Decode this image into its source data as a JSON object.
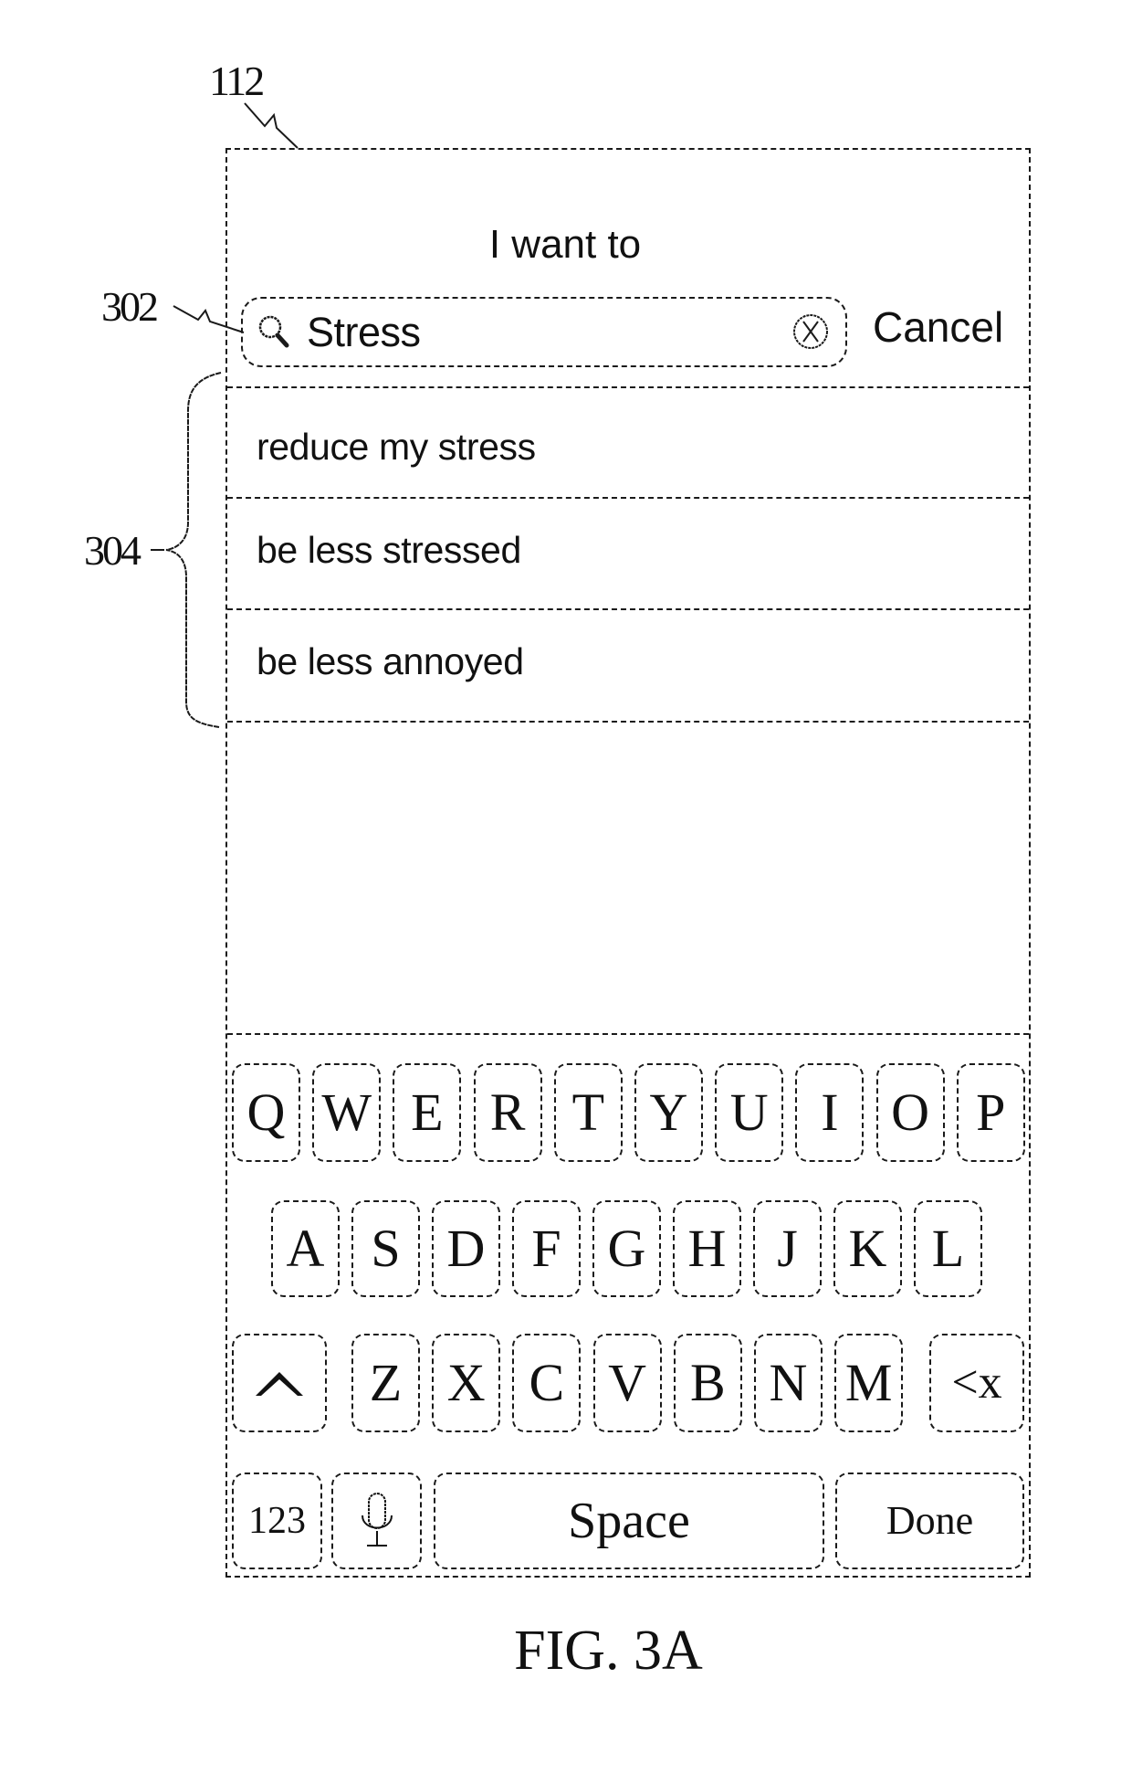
{
  "figure": {
    "caption": "FIG. 3A",
    "reference_numerals": {
      "device_screen": "112",
      "search_field": "302",
      "suggestion_list": "304"
    }
  },
  "header": {
    "title": "I want to"
  },
  "search": {
    "icon": "search-icon",
    "value": "Stress",
    "clear_icon": "clear-circle-x-icon",
    "cancel_label": "Cancel"
  },
  "suggestions": [
    {
      "label": "reduce my stress"
    },
    {
      "label": "be less stressed"
    },
    {
      "label": "be less annoyed"
    }
  ],
  "keyboard": {
    "row1": [
      "Q",
      "W",
      "E",
      "R",
      "T",
      "Y",
      "U",
      "I",
      "O",
      "P"
    ],
    "row2": [
      "A",
      "S",
      "D",
      "F",
      "G",
      "H",
      "J",
      "K",
      "L"
    ],
    "row3_letters": [
      "Z",
      "X",
      "C",
      "V",
      "B",
      "N",
      "M"
    ],
    "shift_icon": "shift-caret-icon",
    "backspace_label": "<x",
    "numbers_label": "123",
    "mic_icon": "microphone-icon",
    "space_label": "Space",
    "done_label": "Done"
  }
}
